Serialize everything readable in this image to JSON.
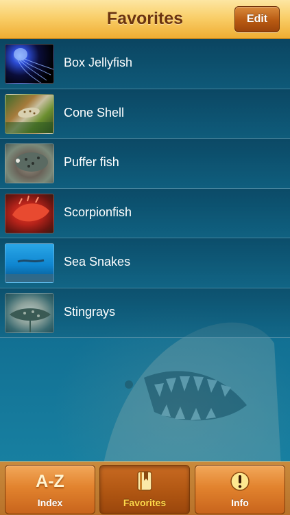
{
  "navbar": {
    "title": "Favorites",
    "edit_label": "Edit"
  },
  "favorites": [
    {
      "label": "Box Jellyfish",
      "thumb": "box-jellyfish-photo"
    },
    {
      "label": "Cone Shell",
      "thumb": "cone-shell-photo"
    },
    {
      "label": "Puffer fish",
      "thumb": "puffer-fish-photo"
    },
    {
      "label": "Scorpionfish",
      "thumb": "scorpionfish-photo"
    },
    {
      "label": "Sea Snakes",
      "thumb": "sea-snakes-photo"
    },
    {
      "label": "Stingrays",
      "thumb": "stingrays-photo"
    }
  ],
  "tabs": [
    {
      "label": "Index",
      "icon_text": "A-Z",
      "icon": "a-z-icon",
      "active": false
    },
    {
      "label": "Favorites",
      "icon": "bookmark-book-icon",
      "active": true
    },
    {
      "label": "Info",
      "icon": "exclamation-icon",
      "active": false
    }
  ],
  "colors": {
    "nav_title": "#6b3410",
    "active_tab_label": "#ffd84a",
    "ocean": "#0d5f80"
  }
}
